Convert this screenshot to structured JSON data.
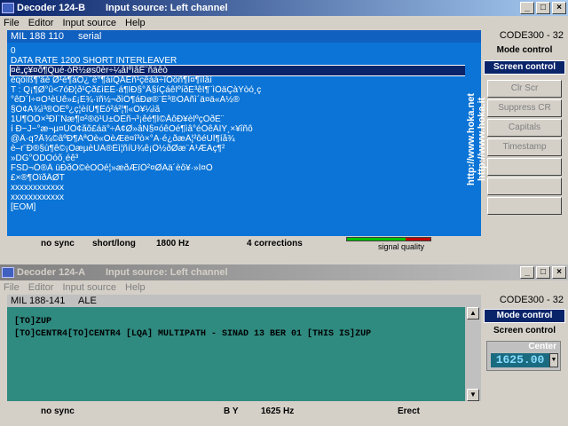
{
  "win1": {
    "title": "Decoder 124-B",
    "source": "Input source: Left channel",
    "menu": [
      "File",
      "Editor",
      "Input source",
      "Help"
    ],
    "mode": "MIL 188 110",
    "mode2": "serial",
    "code": "CODE300 - 32",
    "side_text": "http://www.hoka.net",
    "side_text2": "http://www.hoka.it",
    "lines": [
      "0",
      "DATA RATE 1200  SHORT INTERLEAVER",
      "¤ë„ç¥¤õ¶Qué·òR½øs0èr÷¼âÍºìãË¨ñäêò",
      "ëqöîß¶’äè  Ø¹è¶áÕ¿¨ê°¶àìQÄËñ¹çêàá÷îÖöñ¶Í¤¶ïÍâì",
      "T : Q¡¶Ø°û<7óÐ¦ð¹Çð£ìÊË·á¶ÌÐ§°Å§íÇáêÍºíðÉ³êÎ¶¨ìÖäÇàÝòó¸ç",
      "°êD´Ì÷¤Ó¹èÚê»£¡Ê¾·ïñ½¬ðìÖ¶áÐø®¨Ë³®ÔÁñì´ä¤ä«Á½®",
      "§Õ¢Á¾ì³®ÓÉº¿ç­¦èíÚ¶Êó²á²¦¶«Ô¥¼ìã",
      "1Ú¶ÓÖ×³ÐÎ¨Ñæ¶¤²®­ö¹Ú±ÒËñ¬³¡êé¶Í©ÅôÐ¥èÍºçÒðÈ¨",
      "í Ð~J~°æ¬µ¤ÜÔ¢ãõ£áä°÷Ã¢Ø»âÑ§¤óêÒé¶ìâ°éÔêÄÍÝ¸×¥îñô",
      "@Ä·q?Å¾©âºÐ¶ÁªÕè«ÒèÆë¤î³ò×°Á·é¿ðæÄ¦²ôéÚÏ¶íå¾",
      "è–r¨Ð®§ù¶ê©¡ÓæµèÙÄ®Ëì¦ñíÙ¾ê¡Ô½ðØæ¨Á¹ÆÂç¶²",
      "»DG°ODOóõ¸éê³",
      "FSD¬Ö®Ä üÐðÕ©èÓÕé­¦»æðÆïÖ²¤ØÂä´èô¥·»Í¤Ò",
      "£×®¶ÔïðÄØT",
      "xxxxxxxxxxxx",
      "xxxxxxxxxxxx",
      "[EOM]"
    ],
    "controls": {
      "mode_control": "Mode control",
      "screen_control": "Screen control"
    },
    "buttons": [
      "Clr Scr",
      "Suppress CR",
      "Capitals",
      "Timestamp",
      "",
      "",
      ""
    ],
    "status": {
      "sync": "no sync",
      "il": "short/long",
      "freq": "1800 Hz",
      "corrections": "4 corrections",
      "quality": "signal quality",
      "quality_level": 0.7
    }
  },
  "win2": {
    "title": "Decoder 124-A",
    "source": "Input source: Left channel",
    "menu": [
      "File",
      "Editor",
      "Input source",
      "Help"
    ],
    "mode": "MIL 188-141",
    "mode2": "ALE",
    "code": "CODE300 - 32",
    "lines": [
      "[TO]ZUP",
      "[TO]CENTR4[TO]CENTR4 [LQA]  MULTIPATH - SINAD 13 BER 01 [THIS IS]ZUP"
    ],
    "controls": {
      "mode_control": "Mode control",
      "screen_control": "Screen control"
    },
    "center_label": "Center",
    "center_value": "1625.00",
    "status": {
      "sync": "no sync",
      "by": "B Y",
      "freq": "1625 Hz",
      "erect": "Erect"
    }
  }
}
